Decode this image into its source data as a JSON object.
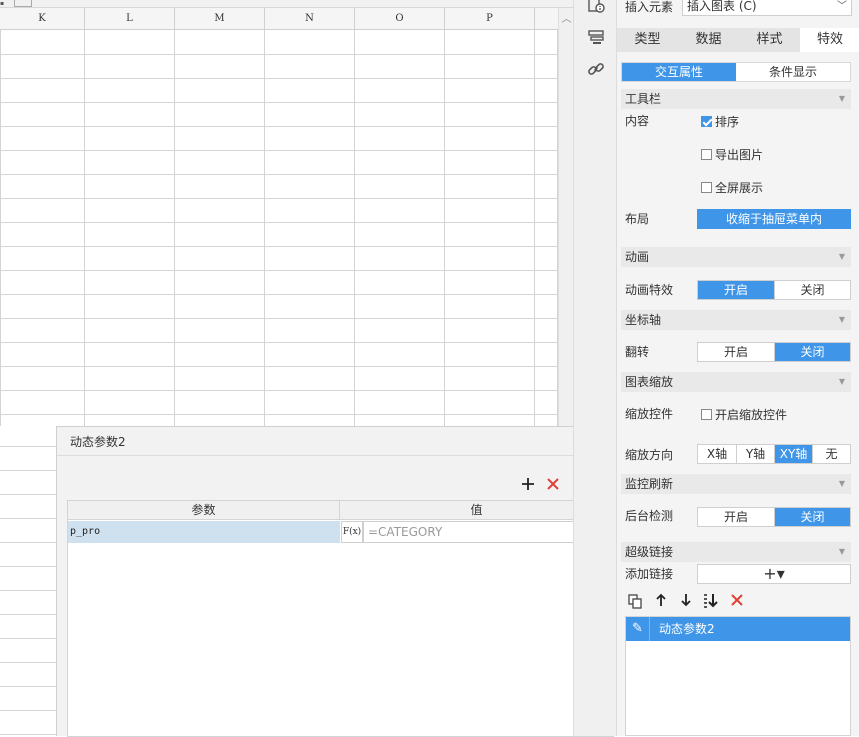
{
  "sheet": {
    "columns": [
      "K",
      "L",
      "M",
      "N",
      "O",
      "P"
    ]
  },
  "dialog": {
    "title": "动态参数2",
    "table": {
      "header_param": "参数",
      "header_value": "值",
      "row": {
        "param": "p_pro",
        "fx_label": "F(x)",
        "value": "=CATEGORY"
      }
    },
    "toolbar_icons": [
      "add-icon",
      "delete-icon",
      "move-up-icon",
      "move-down-icon"
    ]
  },
  "panel": {
    "insert_label": "插入元素",
    "insert_select_value": "插入图表 (C)",
    "tabs": [
      "类型",
      "数据",
      "样式",
      "特效"
    ],
    "active_tab": "特效",
    "subtabs": [
      "交互属性",
      "条件显示"
    ],
    "active_subtab": "交互属性",
    "toolbar_section": "工具栏",
    "content_label": "内容",
    "checkbox_sort": "排序",
    "checkbox_sort_checked": true,
    "checkbox_export": "导出图片",
    "checkbox_export_checked": false,
    "checkbox_fullscreen": "全屏展示",
    "checkbox_fullscreen_checked": false,
    "layout_label": "布局",
    "layout_value": "收缩于抽屉菜单内",
    "animation_section": "动画",
    "animation_effect_label": "动画特效",
    "on_label": "开启",
    "off_label": "关闭",
    "animation_effect_state": "开启",
    "axis_section": "坐标轴",
    "flip_label": "翻转",
    "flip_state": "关闭",
    "zoom_section": "图表缩放",
    "zoom_control_label": "缩放控件",
    "zoom_control_checkbox": "开启缩放控件",
    "zoom_control_checked": false,
    "zoom_direction_label": "缩放方向",
    "zoom_direction_options": [
      "X轴",
      "Y轴",
      "XY轴",
      "无"
    ],
    "zoom_direction_selected": "XY轴",
    "monitor_section": "监控刷新",
    "background_check_label": "后台检测",
    "background_check_state": "关闭",
    "hyperlink_section": "超级链接",
    "add_link_label": "添加链接",
    "add_link_button": "+▾",
    "link_item": "动态参数2"
  },
  "colors": {
    "accent": "#3f95e8",
    "delete_red": "#e0403a",
    "selected_row": "#cfe0ee"
  }
}
